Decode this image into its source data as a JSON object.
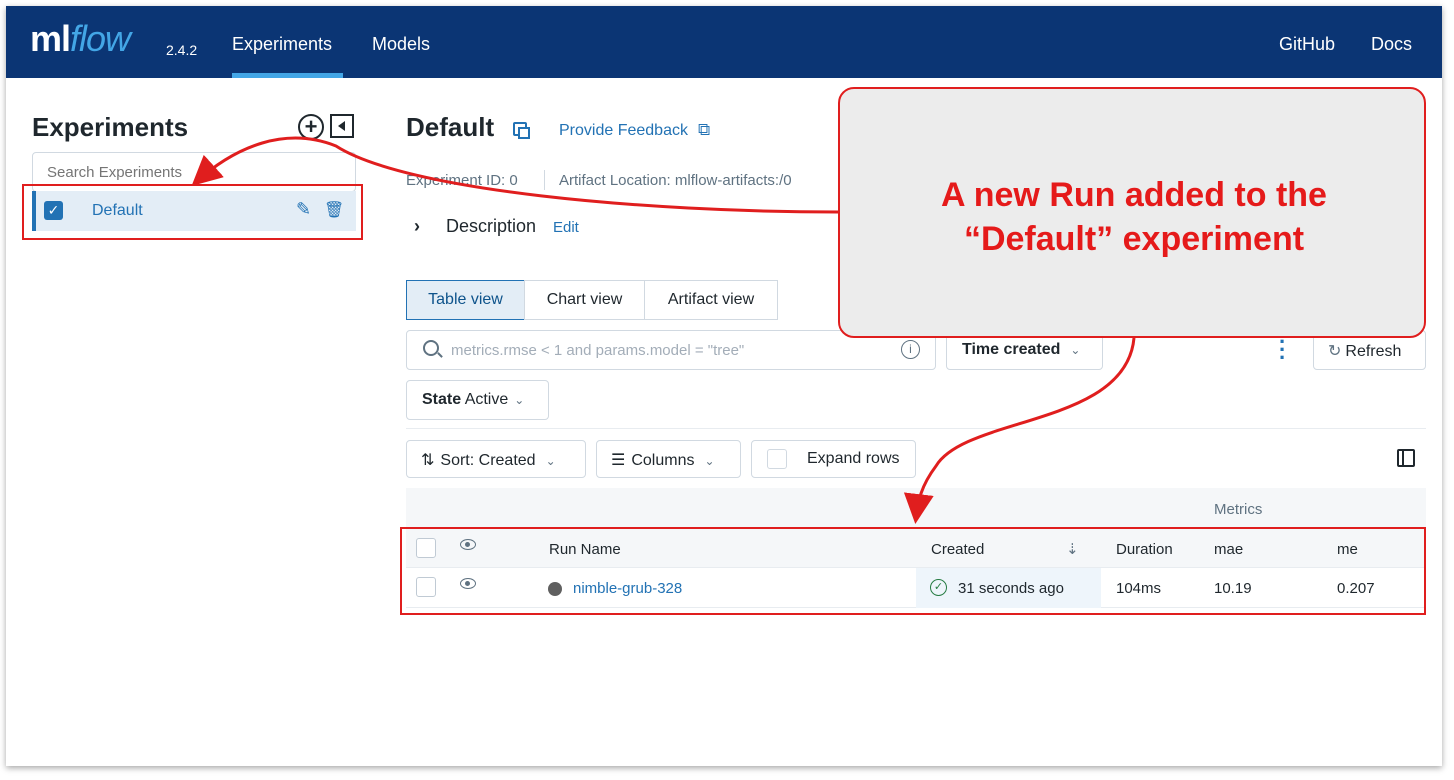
{
  "nav": {
    "logo_ml": "ml",
    "logo_flow": "flow",
    "version": "2.4.2",
    "experiments": "Experiments",
    "models": "Models",
    "github": "GitHub",
    "docs": "Docs"
  },
  "sidebar": {
    "title": "Experiments",
    "search_placeholder": "Search Experiments",
    "items": [
      {
        "label": "Default",
        "checked": true
      }
    ]
  },
  "experiment": {
    "title": "Default",
    "feedback_link": "Provide Feedback",
    "id_text": "Experiment ID: 0",
    "artifact_text": "Artifact Location: mlflow-artifacts:/0",
    "description_label": "Description",
    "description_edit": "Edit"
  },
  "views": {
    "tabs": [
      {
        "label": "Table view",
        "active": true
      },
      {
        "label": "Chart view",
        "active": false
      },
      {
        "label": "Artifact view",
        "active": false
      }
    ]
  },
  "filters": {
    "search_placeholder": "metrics.rmse < 1 and params.model = \"tree\"",
    "time_label": "Time created",
    "refresh_label": "Refresh",
    "state_key": "State",
    "state_value": "Active",
    "sort_label": "Sort: Created",
    "columns_label": "Columns",
    "expand_label": "Expand rows"
  },
  "table": {
    "group_header": "Metrics",
    "columns": {
      "run_name": "Run Name",
      "created": "Created",
      "duration": "Duration",
      "mae": "mae",
      "me": "me"
    },
    "rows": [
      {
        "run_name": "nimble-grub-328",
        "created": "31 seconds ago",
        "duration": "104ms",
        "mae": "10.19",
        "me": "0.207"
      }
    ]
  },
  "annotation": {
    "line1": "A new Run added to the",
    "line2": "“Default” experiment",
    "color": "#e51a1a"
  },
  "colors": {
    "nav_bg": "#0b3574",
    "accent": "#2272b4",
    "flow_blue": "#43a6e6"
  }
}
